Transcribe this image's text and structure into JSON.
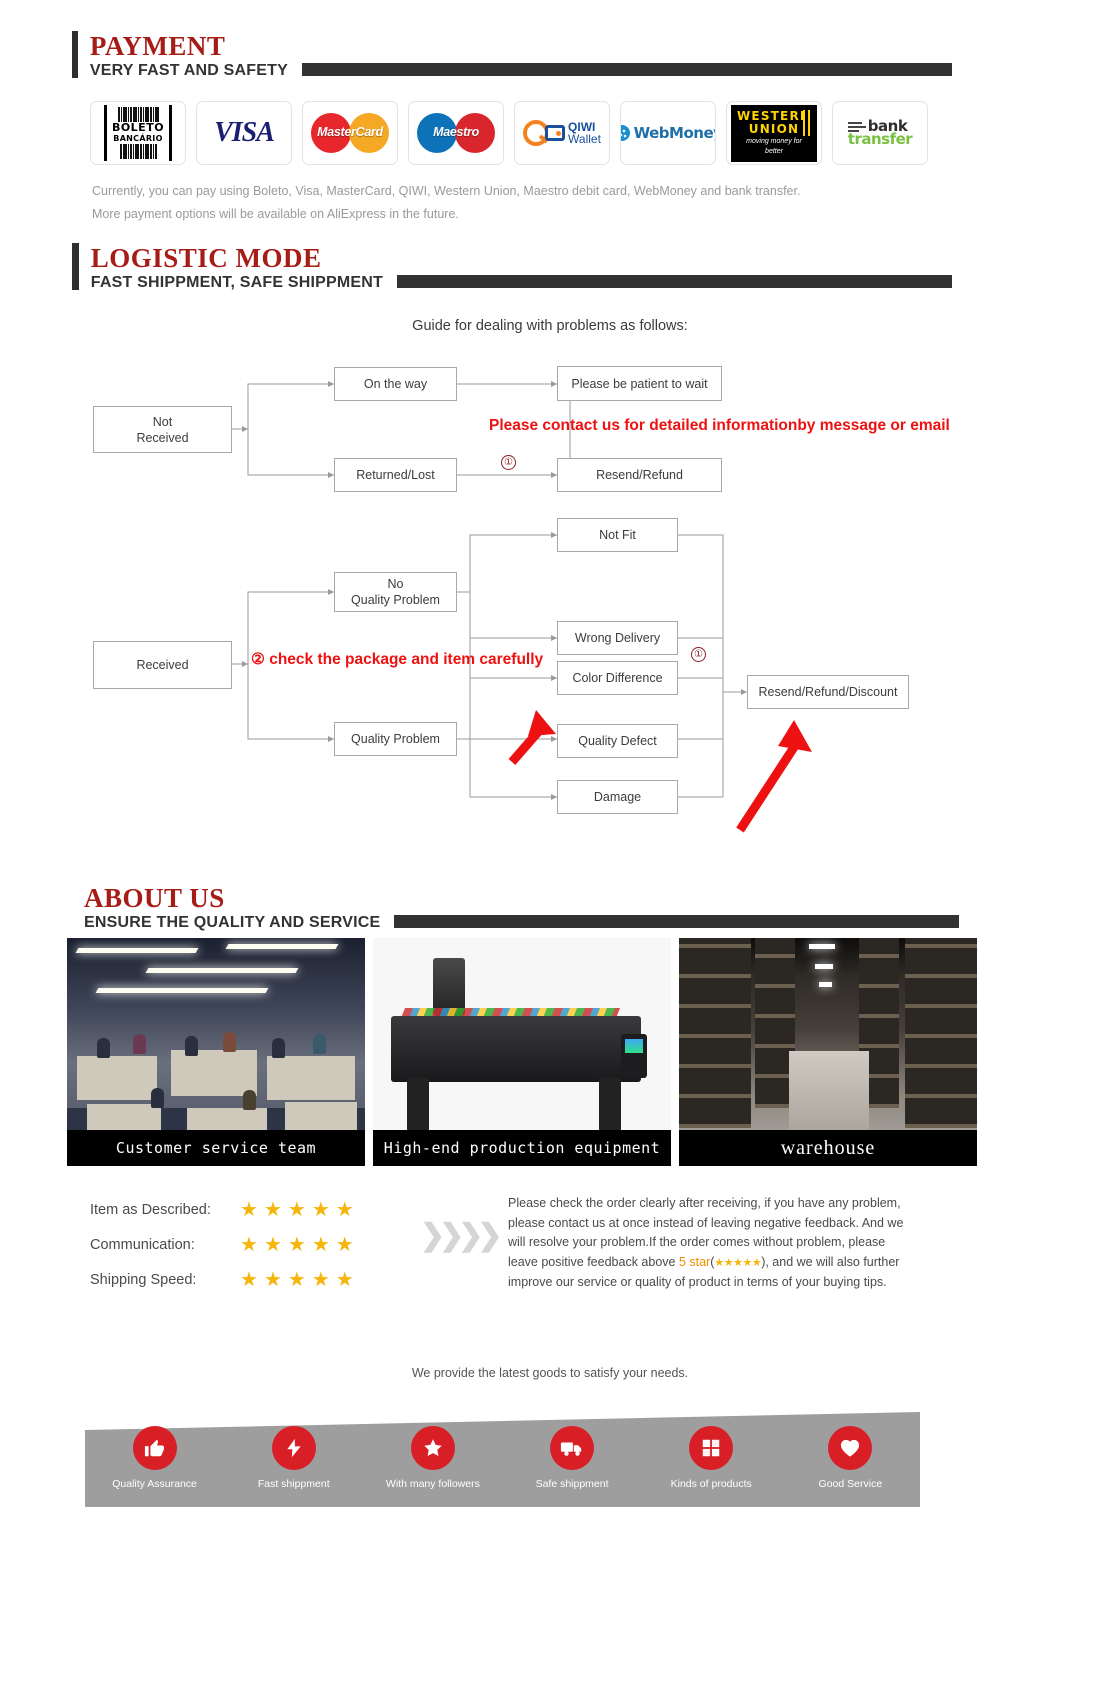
{
  "sections": {
    "payment": {
      "title": "PAYMENT",
      "subtitle": "VERY FAST AND SAFETY"
    },
    "logistic": {
      "title": "LOGISTIC MODE",
      "subtitle": "FAST SHIPPMENT, SAFE SHIPPMENT"
    },
    "about": {
      "title": "ABOUT US",
      "subtitle": "ENSURE THE QUALITY AND SERVICE"
    }
  },
  "payment": {
    "methods": [
      {
        "name": "boleto-bancario",
        "line1": "BOLETO",
        "line2": "BANCÁRIO"
      },
      {
        "name": "visa",
        "label": "VISA"
      },
      {
        "name": "mastercard",
        "label": "MasterCard"
      },
      {
        "name": "maestro",
        "label": "Maestro"
      },
      {
        "name": "qiwi-wallet",
        "line1": "QIWI",
        "line2": "Wallet"
      },
      {
        "name": "webmoney",
        "label": "WebMoney"
      },
      {
        "name": "western-union",
        "line1": "WESTERN",
        "line2": "UNION",
        "line3": "moving money for better"
      },
      {
        "name": "bank-transfer",
        "line1": "bank",
        "line2": "transfer"
      }
    ],
    "note_line1": "Currently, you can pay using Boleto, Visa, MasterCard, QIWI, Western Union, Maestro debit card, WebMoney and bank transfer.",
    "note_line2": "More payment options will be available on AliExpress in the future."
  },
  "flowchart": {
    "title": "Guide for dealing with problems as follows:",
    "boxes": {
      "not_received": "Not\nReceived",
      "on_the_way": "On the way",
      "returned_lost": "Returned/Lost",
      "please_wait": "Please be patient to wait",
      "resend_refund": "Resend/Refund",
      "received": "Received",
      "no_quality_problem": "No\nQuality Problem",
      "quality_problem": "Quality Problem",
      "not_fit": "Not Fit",
      "wrong_delivery": "Wrong Delivery",
      "color_difference": "Color Difference",
      "quality_defect": "Quality Defect",
      "damage": "Damage",
      "resend_refund_discount": "Resend/Refund/Discount"
    },
    "notes": {
      "contact": "Please contact us for detailed informationby message or email",
      "check": "② check the package and item carefully",
      "marker_one": "①",
      "marker_two": "①"
    }
  },
  "about": {
    "photos": [
      {
        "name": "customer-service-team",
        "caption": "Customer service team"
      },
      {
        "name": "production-equipment",
        "caption": "High-end production equipment"
      },
      {
        "name": "warehouse",
        "caption": "warehouse"
      }
    ],
    "ratings": [
      {
        "label": "Item as Described:",
        "stars": 5
      },
      {
        "label": "Communication:",
        "stars": 5
      },
      {
        "label": "Shipping Speed:",
        "stars": 5
      }
    ],
    "chevrons": "❯❯❯❯",
    "feedback_pre": "Please check the order clearly after receiving, if you have any problem, please contact us at once instead of leaving negative feedback. And we will resolve your problem.If the order comes without problem, please leave positive feedback above ",
    "feedback_highlight": "5 star",
    "feedback_stars": "★★★★★",
    "feedback_post": "), and we will also further improve our service or quality of product in terms of your buying tips."
  },
  "tagline": "We provide the latest goods to satisfy your needs.",
  "features": [
    {
      "icon": "thumbs-up-icon",
      "label": "Quality Assurance"
    },
    {
      "icon": "lightning-bolt-icon",
      "label": "Fast shippment"
    },
    {
      "icon": "star-icon",
      "label": "With many followers"
    },
    {
      "icon": "truck-icon",
      "label": "Safe shippment"
    },
    {
      "icon": "puzzle-icon",
      "label": "Kinds of products"
    },
    {
      "icon": "heart-icon",
      "label": "Good Service"
    }
  ],
  "colors": {
    "heading_red": "#a61c16",
    "rule_dark": "#323232",
    "note_red": "#ee1111",
    "star_gold": "#f5b50a",
    "feature_red": "#d81f26",
    "feature_bar_gray": "#9e9e9e"
  }
}
